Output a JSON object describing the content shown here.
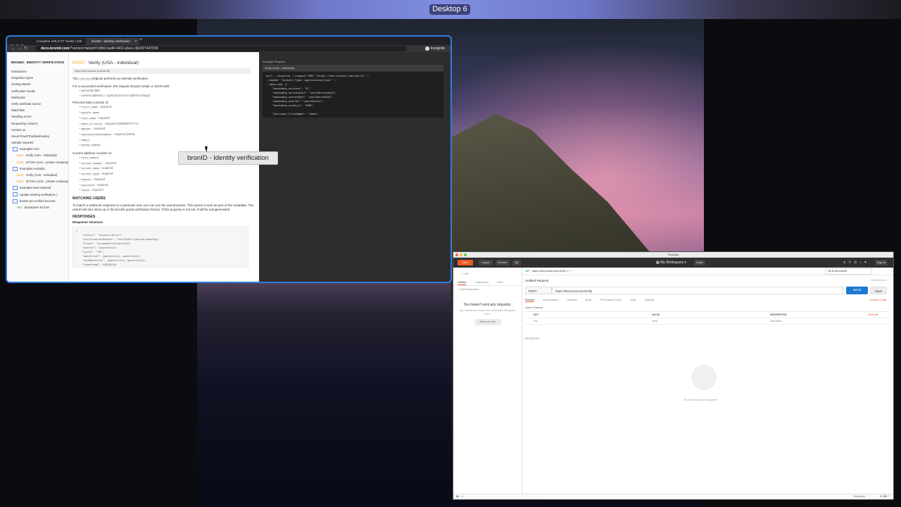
{
  "desktop": {
    "label": "Desktop 6"
  },
  "browser": {
    "tabs": [
      {
        "label": "Complete AML/CTF Toolkit | bro"
      },
      {
        "label": "bronID - Identity verification"
      }
    ],
    "url_domain": "docs.bronid.com",
    "url_path": "/?version=latest#7e8b0-bad8-4463-a6ee-c6b0f27447058",
    "incognito": "Incognito"
  },
  "docs": {
    "brand": "BRONID - IDENTITY VERIFICATION",
    "nav": [
      "Introduction",
      "Integration types",
      "Getting started",
      "Verification results",
      "Webhooks",
      "Verify webhook source",
      "Watchlists",
      "Handling errors",
      "Requesting consent",
      "Contact us",
      "Usual Flows/Troubleshooting",
      "Sample requests"
    ],
    "folders": [
      {
        "label": "Examples USA",
        "requests": [
          {
            "method": "POST",
            "label": "Verify (USA - individual)"
          },
          {
            "method": "POST",
            "label": "ID form (USA - private company)"
          }
        ]
      },
      {
        "label": "Examples Australia",
        "requests": [
          {
            "method": "POST",
            "label": "Verify (AUS - individual)"
          },
          {
            "method": "POST",
            "label": "ID form (AUS - private company)"
          }
        ]
      },
      {
        "label": "Examples New Zealand",
        "requests": []
      },
      {
        "label": "Update missing verification (...",
        "requests": []
      },
      {
        "label": "bronID pre-verified account",
        "requests": [
          {
            "method": "GET",
            "label": "Standalone ID form"
          }
        ]
      }
    ],
    "title_method": "POST",
    "title": "Verify (USA - individual)",
    "endpoint": "https://dev.bronid.com/verify",
    "intro_prefix": "The",
    "intro_code": "/verify",
    "intro_suffix": "endpoint performs an identity verification.",
    "json_line": "For a successful verification, the request should contain a JSON with:",
    "json_items": [
      "personal data",
      "current address (+ optional proof of address image)"
    ],
    "personal_heading": "Personal data consists of:",
    "personal_items": [
      {
        "code": "first name",
        "note": "- required"
      },
      {
        "code": "middle name",
        "note": ""
      },
      {
        "code": "last name",
        "note": "- required"
      },
      {
        "code": "date of birth",
        "note": "- required (DD/MM/YYYY)"
      },
      {
        "code": "gender",
        "note": "- required"
      },
      {
        "code": "nationalIdDocNumber",
        "note": "- required (SSN)"
      },
      {
        "code": "email",
        "note": ""
      },
      {
        "code": "phone number",
        "note": ""
      }
    ],
    "address_heading": "Current address consists of:",
    "address_items": [
      {
        "code": "unit number",
        "note": ""
      },
      {
        "code": "street number",
        "note": "- required"
      },
      {
        "code": "street name",
        "note": "- required"
      },
      {
        "code": "street type",
        "note": "- required"
      },
      {
        "code": "suburb",
        "note": "- required"
      },
      {
        "code": "postcode",
        "note": "- required"
      },
      {
        "code": "state",
        "note": "- required"
      }
    ],
    "matching_heading": "MATCHING USERS",
    "matching_text": "To match a webhook response to a particular user you can use the userId param. This param is sent as part of the metadata. The userId will also show up in the bronID portal verification history. If this property is not set, it will be autogenerated.",
    "responses_heading": "RESPONSES",
    "response_structure": "Response structure",
    "response_code": "{\n    \"status\": \"success/error\",\n    \"verificationStatus\": \"verified/rejected/pending\",\n    \"trace\": \"uniqueVerificationId\",\n    \"userId\": \"yourUserId\",\n    \"score\": \"10\",\n    \"watchlist\": [watchlist1, watchlist2],\n    \"notWatchlist\": [watchlist1, watchlist2],\n    \"timestamp\": 158381234",
    "example_label": "Example Request",
    "example_tab": "Verify (USA - individual)",
    "example_code": "curl --location --request POST 'https://dev.bronid.com/verify' \\\n--header 'Content-Type: application/json' \\\n--data-raw '{\n    \"metadata_version\": \"3\",\n    \"metadata_serviceUid\": \"yourServiceUid\",\n    \"metadata_secretKey\": \"yourSecretKey\",\n    \"metadata_userId\": \"yourUserId\",\n    \"metadata_country\": \"USA\",\n\n    \"personal_firstName\": \"Jane\","
  },
  "tooltip": "bronID - Identity verification",
  "postman": {
    "window_title": "Postman",
    "new": "New",
    "import": "Import",
    "runner": "Runner",
    "workspace": "My Workspace",
    "invite": "Invite",
    "sign_in": "Sign In",
    "filter_placeholder": "Filter",
    "side_tabs": [
      "History",
      "Collections",
      "APIs"
    ],
    "save_responses": "Save Responses",
    "empty_title": "You haven't sent any requests.",
    "empty_sub": "Any request you send in this workspace will appear here.",
    "show_me": "Show me how",
    "request_tab_method": "GET",
    "request_tab": "https://dev.bronid.com/verify",
    "environment": "No Environment",
    "untitled": "Untitled Request",
    "comments": "Comments 0",
    "method": "POST",
    "url": "https://dev.bronid.com/verify",
    "send": "Send",
    "save": "Save",
    "sub_tabs": [
      "Params",
      "Authorization",
      "Headers",
      "Body",
      "Pre-request Script",
      "Tests",
      "Settings"
    ],
    "cookies_code": "Cookies  Code",
    "query_params": "Query Params",
    "table_headers": [
      "KEY",
      "VALUE",
      "DESCRIPTION"
    ],
    "bulk_edit": "Bulk Edit",
    "table_placeholders": [
      "Key",
      "Value",
      "Description"
    ],
    "response": "Response",
    "hit_send": "Hit Send to get a response",
    "bootcamp": "Bootcamp"
  }
}
